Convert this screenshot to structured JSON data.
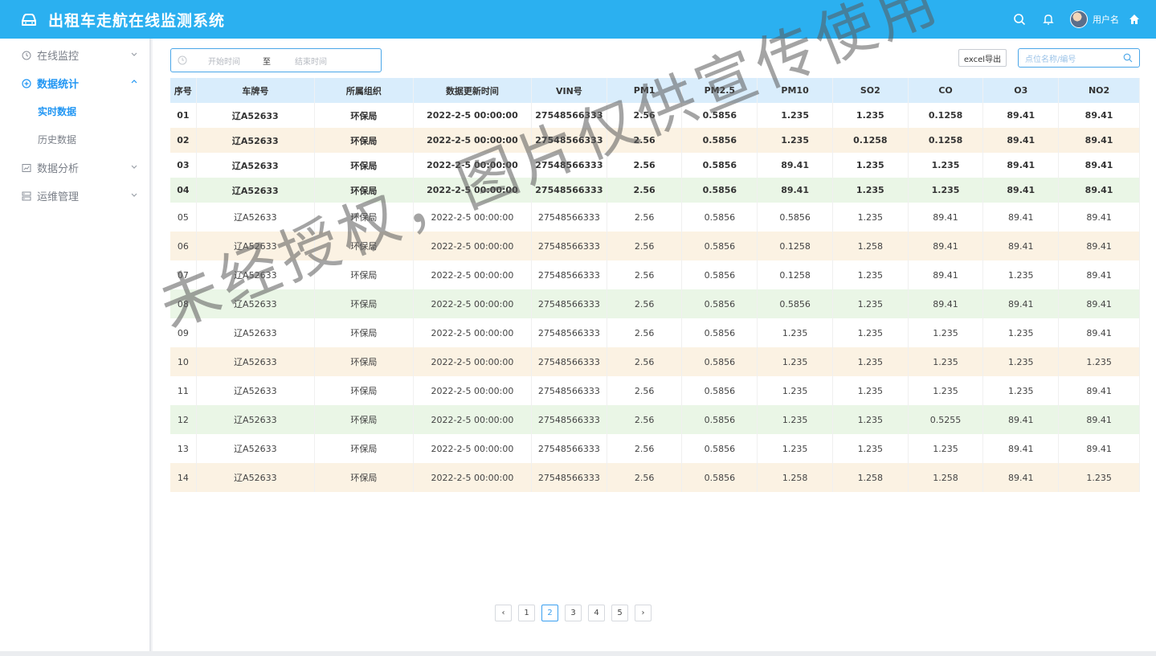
{
  "header": {
    "app_title": "出租车走航在线监测系统",
    "username": "用户名",
    "icons": [
      "car-icon",
      "search-icon",
      "bell-icon",
      "avatar",
      "home-icon"
    ]
  },
  "sidebar": {
    "items": [
      {
        "label": "在线监控",
        "icon": "monitor-icon",
        "expanded": false
      },
      {
        "label": "数据统计",
        "icon": "stats-icon",
        "expanded": true,
        "active": true,
        "children": [
          {
            "label": "实时数据",
            "active": true
          },
          {
            "label": "历史数据",
            "active": false
          }
        ]
      },
      {
        "label": "数据分析",
        "icon": "chart-icon",
        "expanded": false
      },
      {
        "label": "运维管理",
        "icon": "ops-icon",
        "expanded": false
      }
    ]
  },
  "toolbar": {
    "start_placeholder": "开始时间",
    "to_label": "至",
    "end_placeholder": "结束时间",
    "export_label": "excel导出",
    "search_placeholder": "点位名称/编号"
  },
  "table": {
    "columns": [
      "序号",
      "车牌号",
      "所属组织",
      "数据更新时间",
      "VIN号",
      "PM1",
      "PM2.5",
      "PM10",
      "SO2",
      "CO",
      "O3",
      "NO2"
    ],
    "rows": [
      [
        "01",
        "辽A52633",
        "环保局",
        "2022-2-5 00:00:00",
        "27548566333",
        "2.56",
        "0.5856",
        "1.235",
        "1.235",
        "0.1258",
        "89.41",
        "89.41"
      ],
      [
        "02",
        "辽A52633",
        "环保局",
        "2022-2-5 00:00:00",
        "27548566333",
        "2.56",
        "0.5856",
        "1.235",
        "0.1258",
        "0.1258",
        "89.41",
        "89.41"
      ],
      [
        "03",
        "辽A52633",
        "环保局",
        "2022-2-5 00:00:00",
        "27548566333",
        "2.56",
        "0.5856",
        "89.41",
        "1.235",
        "1.235",
        "89.41",
        "89.41"
      ],
      [
        "04",
        "辽A52633",
        "环保局",
        "2022-2-5 00:00:00",
        "27548566333",
        "2.56",
        "0.5856",
        "89.41",
        "1.235",
        "1.235",
        "89.41",
        "89.41"
      ],
      [
        "05",
        "辽A52633",
        "环保局",
        "2022-2-5 00:00:00",
        "27548566333",
        "2.56",
        "0.5856",
        "0.5856",
        "1.235",
        "89.41",
        "89.41",
        "89.41"
      ],
      [
        "06",
        "辽A52633",
        "环保局",
        "2022-2-5 00:00:00",
        "27548566333",
        "2.56",
        "0.5856",
        "0.1258",
        "1.258",
        "89.41",
        "89.41",
        "89.41"
      ],
      [
        "07",
        "辽A52633",
        "环保局",
        "2022-2-5 00:00:00",
        "27548566333",
        "2.56",
        "0.5856",
        "0.1258",
        "1.235",
        "89.41",
        "1.235",
        "89.41"
      ],
      [
        "08",
        "辽A52633",
        "环保局",
        "2022-2-5 00:00:00",
        "27548566333",
        "2.56",
        "0.5856",
        "0.5856",
        "1.235",
        "89.41",
        "89.41",
        "89.41"
      ],
      [
        "09",
        "辽A52633",
        "环保局",
        "2022-2-5 00:00:00",
        "27548566333",
        "2.56",
        "0.5856",
        "1.235",
        "1.235",
        "1.235",
        "1.235",
        "89.41"
      ],
      [
        "10",
        "辽A52633",
        "环保局",
        "2022-2-5 00:00:00",
        "27548566333",
        "2.56",
        "0.5856",
        "1.235",
        "1.235",
        "1.235",
        "1.235",
        "1.235"
      ],
      [
        "11",
        "辽A52633",
        "环保局",
        "2022-2-5 00:00:00",
        "27548566333",
        "2.56",
        "0.5856",
        "1.235",
        "1.235",
        "1.235",
        "1.235",
        "89.41"
      ],
      [
        "12",
        "辽A52633",
        "环保局",
        "2022-2-5 00:00:00",
        "27548566333",
        "2.56",
        "0.5856",
        "1.235",
        "1.235",
        "0.5255",
        "89.41",
        "89.41"
      ],
      [
        "13",
        "辽A52633",
        "环保局",
        "2022-2-5 00:00:00",
        "27548566333",
        "2.56",
        "0.5856",
        "1.235",
        "1.235",
        "1.235",
        "89.41",
        "89.41"
      ],
      [
        "14",
        "辽A52633",
        "环保局",
        "2022-2-5 00:00:00",
        "27548566333",
        "2.56",
        "0.5856",
        "1.258",
        "1.258",
        "1.258",
        "89.41",
        "1.235"
      ]
    ],
    "row_backgrounds": [
      "white",
      "beige",
      "white",
      "green",
      "white",
      "beige",
      "white",
      "green",
      "white",
      "beige",
      "white",
      "green",
      "white",
      "beige"
    ]
  },
  "pagination": {
    "prev": "‹",
    "pages": [
      "1",
      "2",
      "3",
      "4",
      "5"
    ],
    "current": "2",
    "next": "›"
  },
  "watermark": "未经授权，图片仅供宣传使用",
  "colors": {
    "header_bg": "#2bb0f0",
    "accent": "#2196f3",
    "table_head_bg": "#d9edfc",
    "row_beige": "#fbf2e3",
    "row_green": "#eaf6e6"
  }
}
